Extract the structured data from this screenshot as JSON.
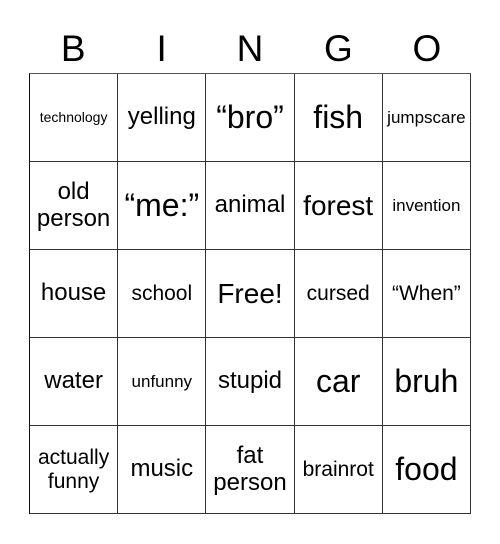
{
  "header": {
    "letters": [
      "B",
      "I",
      "N",
      "G",
      "O"
    ]
  },
  "cells": [
    [
      "technology",
      "yelling",
      "“bro”",
      "fish",
      "jumpscare"
    ],
    [
      "old person",
      "“me:”",
      "animal",
      "forest",
      "invention"
    ],
    [
      "house",
      "school",
      "Free!",
      "cursed",
      "“When”"
    ],
    [
      "water",
      "unfunny",
      "stupid",
      "car",
      "bruh"
    ],
    [
      "actually funny",
      "music",
      "fat person",
      "brainrot",
      "food"
    ]
  ],
  "free_space": "Free!"
}
